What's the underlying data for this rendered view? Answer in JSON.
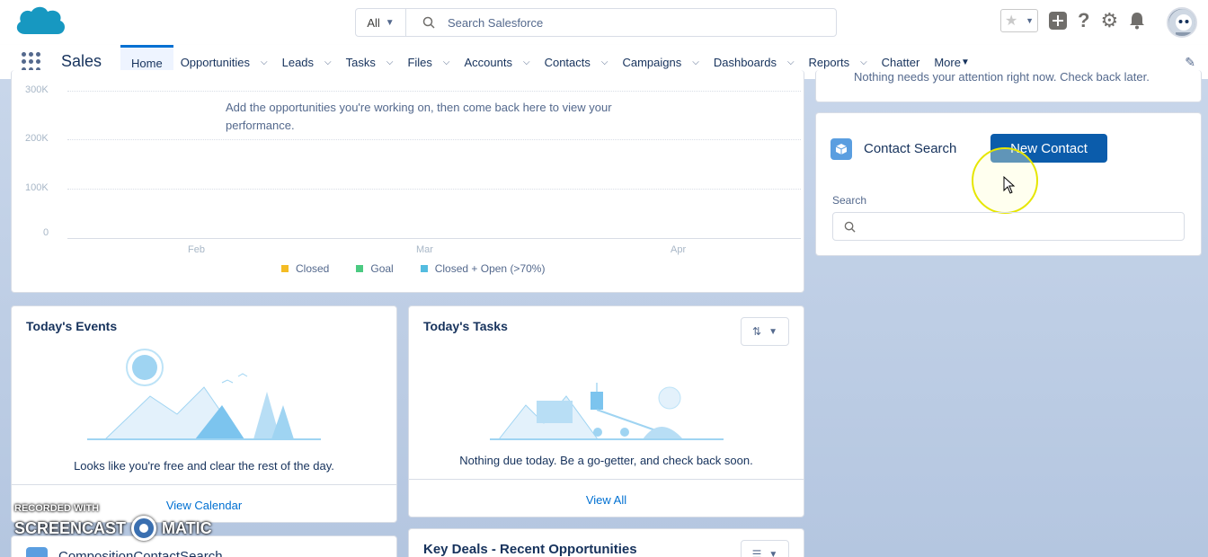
{
  "header": {
    "search_scope": "All",
    "search_placeholder": "Search Salesforce"
  },
  "nav": {
    "app_name": "Sales",
    "tabs": [
      {
        "label": "Home",
        "active": true,
        "dropdown": false
      },
      {
        "label": "Opportunities",
        "dropdown": true
      },
      {
        "label": "Leads",
        "dropdown": true
      },
      {
        "label": "Tasks",
        "dropdown": true
      },
      {
        "label": "Files",
        "dropdown": true
      },
      {
        "label": "Accounts",
        "dropdown": true
      },
      {
        "label": "Contacts",
        "dropdown": true
      },
      {
        "label": "Campaigns",
        "dropdown": true
      },
      {
        "label": "Dashboards",
        "dropdown": true
      },
      {
        "label": "Reports",
        "dropdown": true
      },
      {
        "label": "Chatter",
        "dropdown": false
      },
      {
        "label": "More",
        "dropdown": true
      }
    ]
  },
  "performance_chart": {
    "y_ticks": [
      "300K",
      "200K",
      "100K",
      "0"
    ],
    "x_ticks": [
      "Feb",
      "Mar",
      "Apr"
    ],
    "empty_message": "Add the opportunities you're working on, then come back here to view your performance.",
    "legend": [
      {
        "label": "Closed",
        "color": "#f4bc25"
      },
      {
        "label": "Goal",
        "color": "#4bca81"
      },
      {
        "label": "Closed + Open (>70%)",
        "color": "#54bce0"
      }
    ]
  },
  "todays_events": {
    "title": "Today's Events",
    "empty_message": "Looks like you're free and clear the rest of the day.",
    "footer_link": "View Calendar"
  },
  "todays_tasks": {
    "title": "Today's Tasks",
    "empty_message": "Nothing due today. Be a go-getter, and check back soon.",
    "footer_link": "View All"
  },
  "key_deals": {
    "title": "Key Deals - Recent Opportunities"
  },
  "composition_card": {
    "title": "CompositionContactSearch"
  },
  "assistant": {
    "message": "Nothing needs your attention right now. Check back later."
  },
  "contact_search": {
    "title": "Contact Search",
    "new_contact_label": "New Contact",
    "search_label": "Search",
    "search_value": ""
  },
  "watermark": {
    "line1": "RECORDED WITH",
    "line2a": "SCREENCAST",
    "line2b": "MATIC"
  }
}
